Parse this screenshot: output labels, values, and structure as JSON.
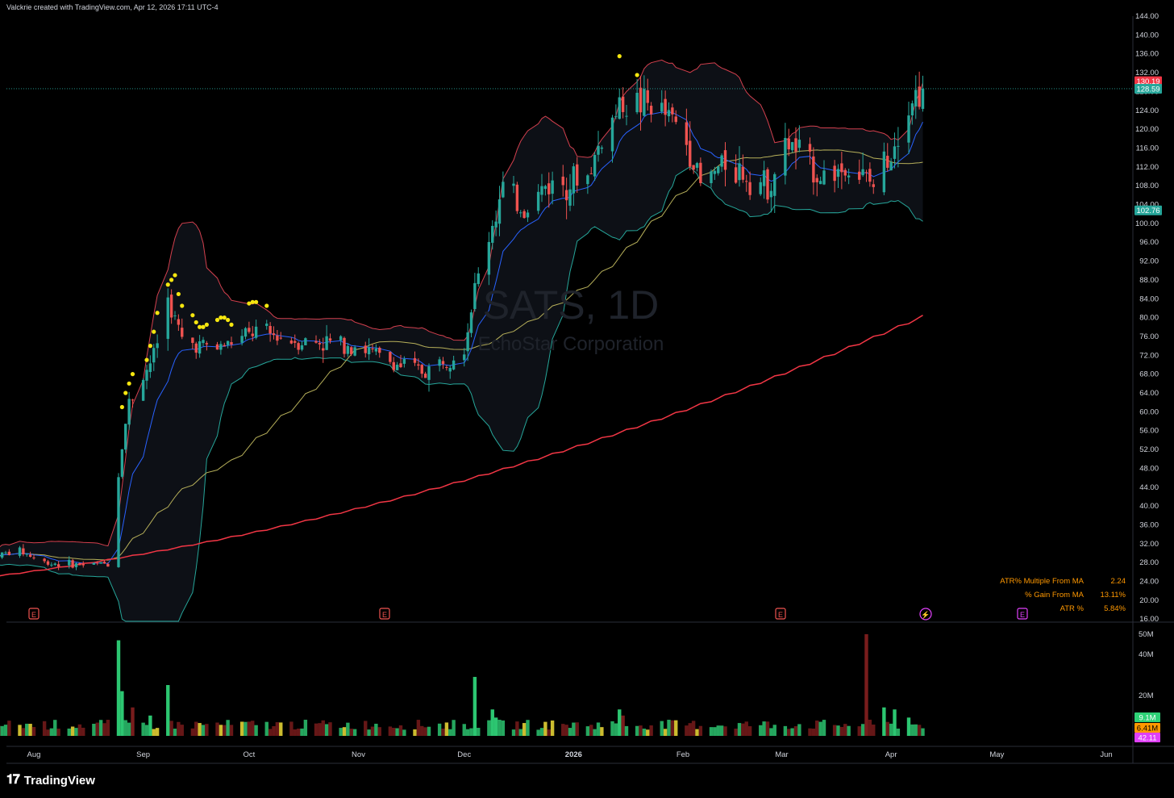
{
  "header": {
    "text": "Valckrie created with TradingView.com, Apr 12, 2026 17:11 UTC-4"
  },
  "brand": {
    "name": "TradingView"
  },
  "watermark": {
    "symbol": "SATS, 1D",
    "company": "EchoStar Corporation"
  },
  "colors": {
    "up": "#26a69a",
    "down": "#ef5350",
    "ema": "#2962ff",
    "sma50": "#b7b05a",
    "sma200": "#f23645",
    "bb": "#d3404e",
    "bb_lower": "#26a69a",
    "dots": "#f5e60f",
    "vol_up": "#2ed177",
    "vol_down": "#7f1d1d",
    "vol_high": "#ffeb3b",
    "stats": "#ff9800",
    "grid": "#1c1f26"
  },
  "price_axis": {
    "ticks": [
      "144.00",
      "140.00",
      "136.00",
      "132.00",
      "128.00",
      "124.00",
      "120.00",
      "116.00",
      "112.00",
      "108.00",
      "104.00",
      "100.00",
      "96.00",
      "92.00",
      "88.00",
      "84.00",
      "80.00",
      "76.00",
      "72.00",
      "68.00",
      "64.00",
      "60.00",
      "56.00",
      "52.00",
      "48.00",
      "44.00",
      "40.00",
      "36.00",
      "32.00",
      "28.00",
      "24.00",
      "20.00",
      "16.00"
    ],
    "labels": [
      {
        "text": "130.19",
        "value": 130.19,
        "color": "#f23645"
      },
      {
        "text": "128.59",
        "value": 128.59,
        "color": "#26a69a"
      },
      {
        "text": "102.76",
        "value": 102.76,
        "color": "#26a69a"
      }
    ]
  },
  "volume_axis": {
    "ticks": [
      "50M",
      "40M",
      "20M"
    ],
    "labels": [
      {
        "text": "9.1M",
        "color": "#2ed177"
      },
      {
        "text": "6.41M",
        "color": "#ff9800"
      },
      {
        "text": "42.11",
        "color": "#e040fb"
      }
    ]
  },
  "time_axis": {
    "labels": [
      "Aug",
      "Sep",
      "Oct",
      "Nov",
      "Dec",
      "2026",
      "Feb",
      "Mar",
      "Apr",
      "May",
      "Jun"
    ]
  },
  "events": [
    "E",
    "E",
    "E",
    "⚡",
    "E"
  ],
  "stats": [
    {
      "label": "ATR% Multiple From MA",
      "value": "2.24"
    },
    {
      "label": "% Gain From MA",
      "value": "13.11%"
    },
    {
      "label": "ATR %",
      "value": "5.84%"
    }
  ],
  "chart_data": {
    "type": "candlestick",
    "symbol": "SATS",
    "interval": "1D",
    "price_range": [
      16,
      144
    ],
    "last_price": 128.59,
    "control_points": [
      {
        "d": "2025-07-21",
        "close": 29.5
      },
      {
        "d": "2025-07-28",
        "close": 30.5
      },
      {
        "d": "2025-08-04",
        "close": 28.0
      },
      {
        "d": "2025-08-15",
        "close": 27.5
      },
      {
        "d": "2025-08-22",
        "close": 27.8
      },
      {
        "d": "2025-08-26",
        "close": 53
      },
      {
        "d": "2025-08-28",
        "close": 62
      },
      {
        "d": "2025-09-04",
        "close": 72
      },
      {
        "d": "2025-09-08",
        "close": 84
      },
      {
        "d": "2025-09-12",
        "close": 75
      },
      {
        "d": "2025-09-22",
        "close": 73.5
      },
      {
        "d": "2025-10-03",
        "close": 77
      },
      {
        "d": "2025-10-15",
        "close": 75
      },
      {
        "d": "2025-10-30",
        "close": 74.5
      },
      {
        "d": "2025-11-12",
        "close": 70
      },
      {
        "d": "2025-11-20",
        "close": 68.5
      },
      {
        "d": "2025-12-01",
        "close": 74
      },
      {
        "d": "2025-12-04",
        "close": 86
      },
      {
        "d": "2025-12-09",
        "close": 100
      },
      {
        "d": "2025-12-12",
        "close": 107
      },
      {
        "d": "2025-12-18",
        "close": 103
      },
      {
        "d": "2025-12-24",
        "close": 108
      },
      {
        "d": "2026-01-05",
        "close": 110
      },
      {
        "d": "2026-01-09",
        "close": 118
      },
      {
        "d": "2026-01-15",
        "close": 126
      },
      {
        "d": "2026-01-23",
        "close": 125
      },
      {
        "d": "2026-01-29",
        "close": 122
      },
      {
        "d": "2026-02-03",
        "close": 116
      },
      {
        "d": "2026-02-06",
        "close": 108
      },
      {
        "d": "2026-02-13",
        "close": 113
      },
      {
        "d": "2026-02-25",
        "close": 108
      },
      {
        "d": "2026-03-03",
        "close": 117
      },
      {
        "d": "2026-03-12",
        "close": 110
      },
      {
        "d": "2026-03-20",
        "close": 112
      },
      {
        "d": "2026-03-27",
        "close": 108
      },
      {
        "d": "2026-04-01",
        "close": 116
      },
      {
        "d": "2026-04-06",
        "close": 126
      },
      {
        "d": "2026-04-10",
        "close": 128.59
      }
    ],
    "indicators": {
      "bollinger_bands": {
        "upper_last": 130.19,
        "lower_last": 102.76
      },
      "moving_averages": [
        "EMA",
        "SMA 50",
        "SMA 200"
      ],
      "sma200_last": 80.5
    },
    "volume": {
      "max": "50M",
      "last": "9.1M",
      "avg": "6.41M"
    }
  }
}
